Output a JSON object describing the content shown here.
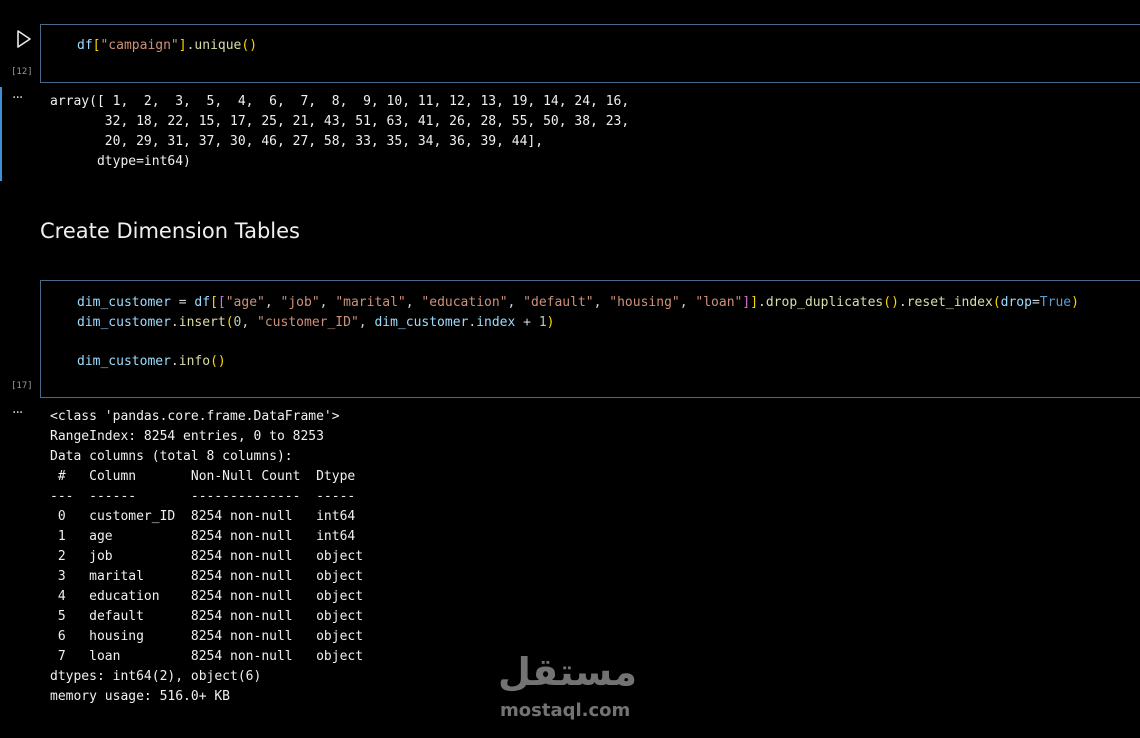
{
  "cells": [
    {
      "execution_count": "[12]",
      "code_tokens": [
        [
          {
            "t": "df",
            "c": "v"
          },
          {
            "t": "[",
            "c": "b1"
          },
          {
            "t": "\"campaign\"",
            "c": "s"
          },
          {
            "t": "]",
            "c": "b1"
          },
          {
            "t": ".",
            "c": "p"
          },
          {
            "t": "unique",
            "c": "f"
          },
          {
            "t": "()",
            "c": "b1"
          }
        ]
      ],
      "output_lines": [
        "array([ 1,  2,  3,  5,  4,  6,  7,  8,  9, 10, 11, 12, 13, 19, 14, 24, 16,",
        "       32, 18, 22, 15, 17, 25, 21, 43, 51, 63, 41, 26, 28, 55, 50, 38, 23,",
        "       20, 29, 31, 37, 30, 46, 27, 58, 33, 35, 34, 36, 39, 44],",
        "      dtype=int64)"
      ]
    },
    {
      "execution_count": "[17]",
      "code_tokens": [
        [
          {
            "t": "dim_customer",
            "c": "v"
          },
          {
            "t": " = ",
            "c": "p"
          },
          {
            "t": "df",
            "c": "v"
          },
          {
            "t": "[",
            "c": "b1"
          },
          {
            "t": "[",
            "c": "b2"
          },
          {
            "t": "\"age\"",
            "c": "s"
          },
          {
            "t": ", ",
            "c": "p"
          },
          {
            "t": "\"job\"",
            "c": "s"
          },
          {
            "t": ", ",
            "c": "p"
          },
          {
            "t": "\"marital\"",
            "c": "s"
          },
          {
            "t": ", ",
            "c": "p"
          },
          {
            "t": "\"education\"",
            "c": "s"
          },
          {
            "t": ", ",
            "c": "p"
          },
          {
            "t": "\"default\"",
            "c": "s"
          },
          {
            "t": ", ",
            "c": "p"
          },
          {
            "t": "\"housing\"",
            "c": "s"
          },
          {
            "t": ", ",
            "c": "p"
          },
          {
            "t": "\"loan\"",
            "c": "s"
          },
          {
            "t": "]",
            "c": "b2"
          },
          {
            "t": "]",
            "c": "b1"
          },
          {
            "t": ".",
            "c": "p"
          },
          {
            "t": "drop_duplicates",
            "c": "f"
          },
          {
            "t": "()",
            "c": "b1"
          },
          {
            "t": ".",
            "c": "p"
          },
          {
            "t": "reset_index",
            "c": "f"
          },
          {
            "t": "(",
            "c": "b1"
          },
          {
            "t": "drop",
            "c": "v"
          },
          {
            "t": "=",
            "c": "p"
          },
          {
            "t": "True",
            "c": "k"
          },
          {
            "t": ")",
            "c": "b1"
          }
        ],
        [
          {
            "t": "dim_customer",
            "c": "v"
          },
          {
            "t": ".",
            "c": "p"
          },
          {
            "t": "insert",
            "c": "f"
          },
          {
            "t": "(",
            "c": "b1"
          },
          {
            "t": "0",
            "c": "n"
          },
          {
            "t": ", ",
            "c": "p"
          },
          {
            "t": "\"customer_ID\"",
            "c": "s"
          },
          {
            "t": ", ",
            "c": "p"
          },
          {
            "t": "dim_customer",
            "c": "v"
          },
          {
            "t": ".",
            "c": "p"
          },
          {
            "t": "index",
            "c": "v"
          },
          {
            "t": " + ",
            "c": "p"
          },
          {
            "t": "1",
            "c": "n"
          },
          {
            "t": ")",
            "c": "b1"
          }
        ],
        [],
        [
          {
            "t": "dim_customer",
            "c": "v"
          },
          {
            "t": ".",
            "c": "p"
          },
          {
            "t": "info",
            "c": "f"
          },
          {
            "t": "()",
            "c": "b1"
          }
        ]
      ],
      "output_lines": [
        "<class 'pandas.core.frame.DataFrame'>",
        "RangeIndex: 8254 entries, 0 to 8253",
        "Data columns (total 8 columns):",
        " #   Column       Non-Null Count  Dtype ",
        "---  ------       --------------  ----- ",
        " 0   customer_ID  8254 non-null   int64 ",
        " 1   age          8254 non-null   int64 ",
        " 2   job          8254 non-null   object",
        " 3   marital      8254 non-null   object",
        " 4   education    8254 non-null   object",
        " 5   default      8254 non-null   object",
        " 6   housing      8254 non-null   object",
        " 7   loan         8254 non-null   object",
        "dtypes: int64(2), object(6)",
        "memory usage: 516.0+ KB"
      ]
    }
  ],
  "markdown_heading": "Create Dimension Tables",
  "output_menu_label": "···",
  "watermark": {
    "arabic": "مستقل",
    "latin": "mostaql.com"
  },
  "colors": {
    "cell_border": "#4a6a8a",
    "active_bar": "#3c90d6",
    "background": "#000000"
  }
}
